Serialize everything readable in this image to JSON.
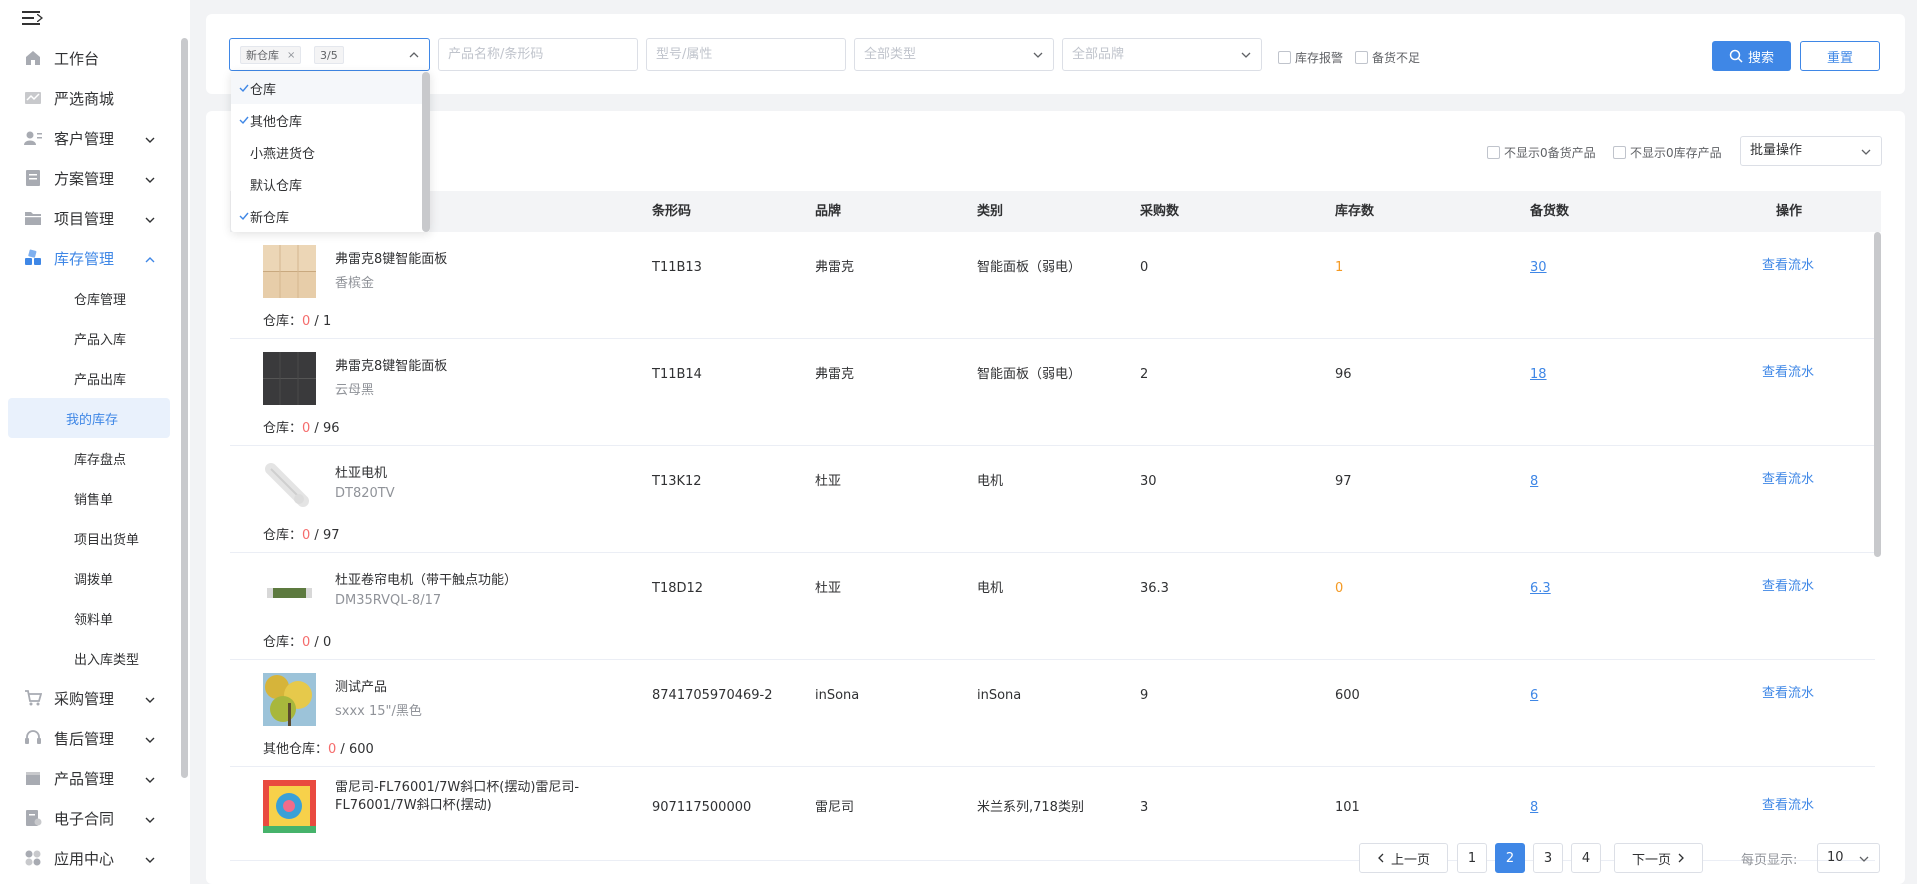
{
  "sidebar": {
    "items": [
      {
        "label": "工作台",
        "icon": "home-icon"
      },
      {
        "label": "严选商城",
        "icon": "mall-icon"
      },
      {
        "label": "客户管理",
        "icon": "customer-icon",
        "expandable": true
      },
      {
        "label": "方案管理",
        "icon": "plan-icon",
        "expandable": true
      },
      {
        "label": "项目管理",
        "icon": "folder-icon",
        "expandable": true
      },
      {
        "label": "库存管理",
        "icon": "inventory-icon",
        "expandable": true,
        "active": true
      },
      {
        "label": "采购管理",
        "icon": "cart-icon",
        "expandable": true
      },
      {
        "label": "售后管理",
        "icon": "headset-icon",
        "expandable": true
      },
      {
        "label": "产品管理",
        "icon": "product-icon",
        "expandable": true
      },
      {
        "label": "电子合同",
        "icon": "contract-icon",
        "expandable": true
      },
      {
        "label": "应用中心",
        "icon": "apps-icon",
        "expandable": true
      }
    ],
    "subitems": [
      "仓库管理",
      "产品入库",
      "产品出库",
      "我的库存",
      "库存盘点",
      "销售单",
      "项目出货单",
      "调拨单",
      "领料单",
      "出入库类型"
    ],
    "selected_subitem": "我的库存"
  },
  "filters": {
    "warehouse_tag": "新仓库",
    "warehouse_count": "3/5",
    "product_placeholder": "产品名称/条形码",
    "model_placeholder": "型号/属性",
    "type_placeholder": "全部类型",
    "brand_placeholder": "全部品牌",
    "cb_alarm": "库存报警",
    "cb_shortage": "备货不足",
    "search_label": "搜索",
    "reset_label": "重置"
  },
  "dropdown": {
    "options": [
      {
        "label": "仓库",
        "checked": true
      },
      {
        "label": "其他仓库",
        "checked": true
      },
      {
        "label": "小燕进货仓",
        "checked": false
      },
      {
        "label": "默认仓库",
        "checked": false
      },
      {
        "label": "新仓库",
        "checked": true
      }
    ]
  },
  "toolbar": {
    "hide_zero_prepare": "不显示0备货产品",
    "hide_zero_stock": "不显示0库存产品",
    "batch_label": "批量操作"
  },
  "table": {
    "headers": [
      "条形码",
      "品牌",
      "类别",
      "采购数",
      "库存数",
      "备货数",
      "操作"
    ],
    "rows": [
      {
        "name": "弗雷克8键智能面板",
        "spec": "香槟金",
        "stock_prefix": "仓库：",
        "stock_zero": "0",
        "stock_total": " / 1",
        "barcode": "T11B13",
        "brand": "弗雷克",
        "category": "智能面板（弱电）",
        "purchase": "0",
        "stock": "1",
        "stock_color": "orange",
        "prepare": "30",
        "op": "查看流水",
        "thumb": "gold"
      },
      {
        "name": "弗雷克8键智能面板",
        "spec": "云母黑",
        "stock_prefix": "仓库：",
        "stock_zero": "0",
        "stock_total": " / 96",
        "barcode": "T11B14",
        "brand": "弗雷克",
        "category": "智能面板（弱电）",
        "purchase": "2",
        "stock": "96",
        "stock_color": "normal",
        "prepare": "18",
        "op": "查看流水",
        "thumb": "black"
      },
      {
        "name": "杜亚电机",
        "spec": "DT820TV",
        "stock_prefix": "仓库：",
        "stock_zero": "0",
        "stock_total": " / 97",
        "barcode": "T13K12",
        "brand": "杜亚",
        "category": "电机",
        "purchase": "30",
        "stock": "97",
        "stock_color": "normal",
        "prepare": "8",
        "op": "查看流水",
        "thumb": "motor"
      },
      {
        "name": "杜亚卷帘电机（带干触点功能）",
        "spec": "DM35RVQL-8/17",
        "stock_prefix": "仓库：",
        "stock_zero": "0",
        "stock_total": " / 0",
        "barcode": "T18D12",
        "brand": "杜亚",
        "category": "电机",
        "purchase": "36.3",
        "stock": "0",
        "stock_color": "orange",
        "prepare": "6.3",
        "op": "查看流水",
        "thumb": "tube"
      },
      {
        "name": "测试产品",
        "spec": "sxxx 15\"/黑色",
        "stock_prefix": "其他仓库：",
        "stock_zero": "0",
        "stock_total": " / 600",
        "barcode": "8741705970469-2",
        "brand": "inSona",
        "category": "inSona",
        "purchase": "9",
        "stock": "600",
        "stock_color": "normal",
        "prepare": "6",
        "op": "查看流水",
        "thumb": "tree"
      },
      {
        "name": "雷尼司-FL76001/7W斜口杯(摆动)雷尼司-FL76001/7W斜口杯(摆动)",
        "spec": "",
        "stock_prefix": "",
        "stock_zero": "",
        "stock_total": "",
        "barcode": "907117500000",
        "brand": "雷尼司",
        "category": "米兰系列,718类别",
        "purchase": "3",
        "stock": "101",
        "stock_color": "normal",
        "prepare": "8",
        "op": "查看流水",
        "thumb": "colorful"
      }
    ]
  },
  "pagination": {
    "prev": "上一页",
    "pages": [
      "1",
      "2",
      "3",
      "4"
    ],
    "current": "2",
    "next": "下一页",
    "per_page_label": "每页显示:",
    "per_page": "10"
  },
  "colors": {
    "accent": "#3f87e6",
    "orange": "#f59a23",
    "red": "#f56c6c"
  }
}
